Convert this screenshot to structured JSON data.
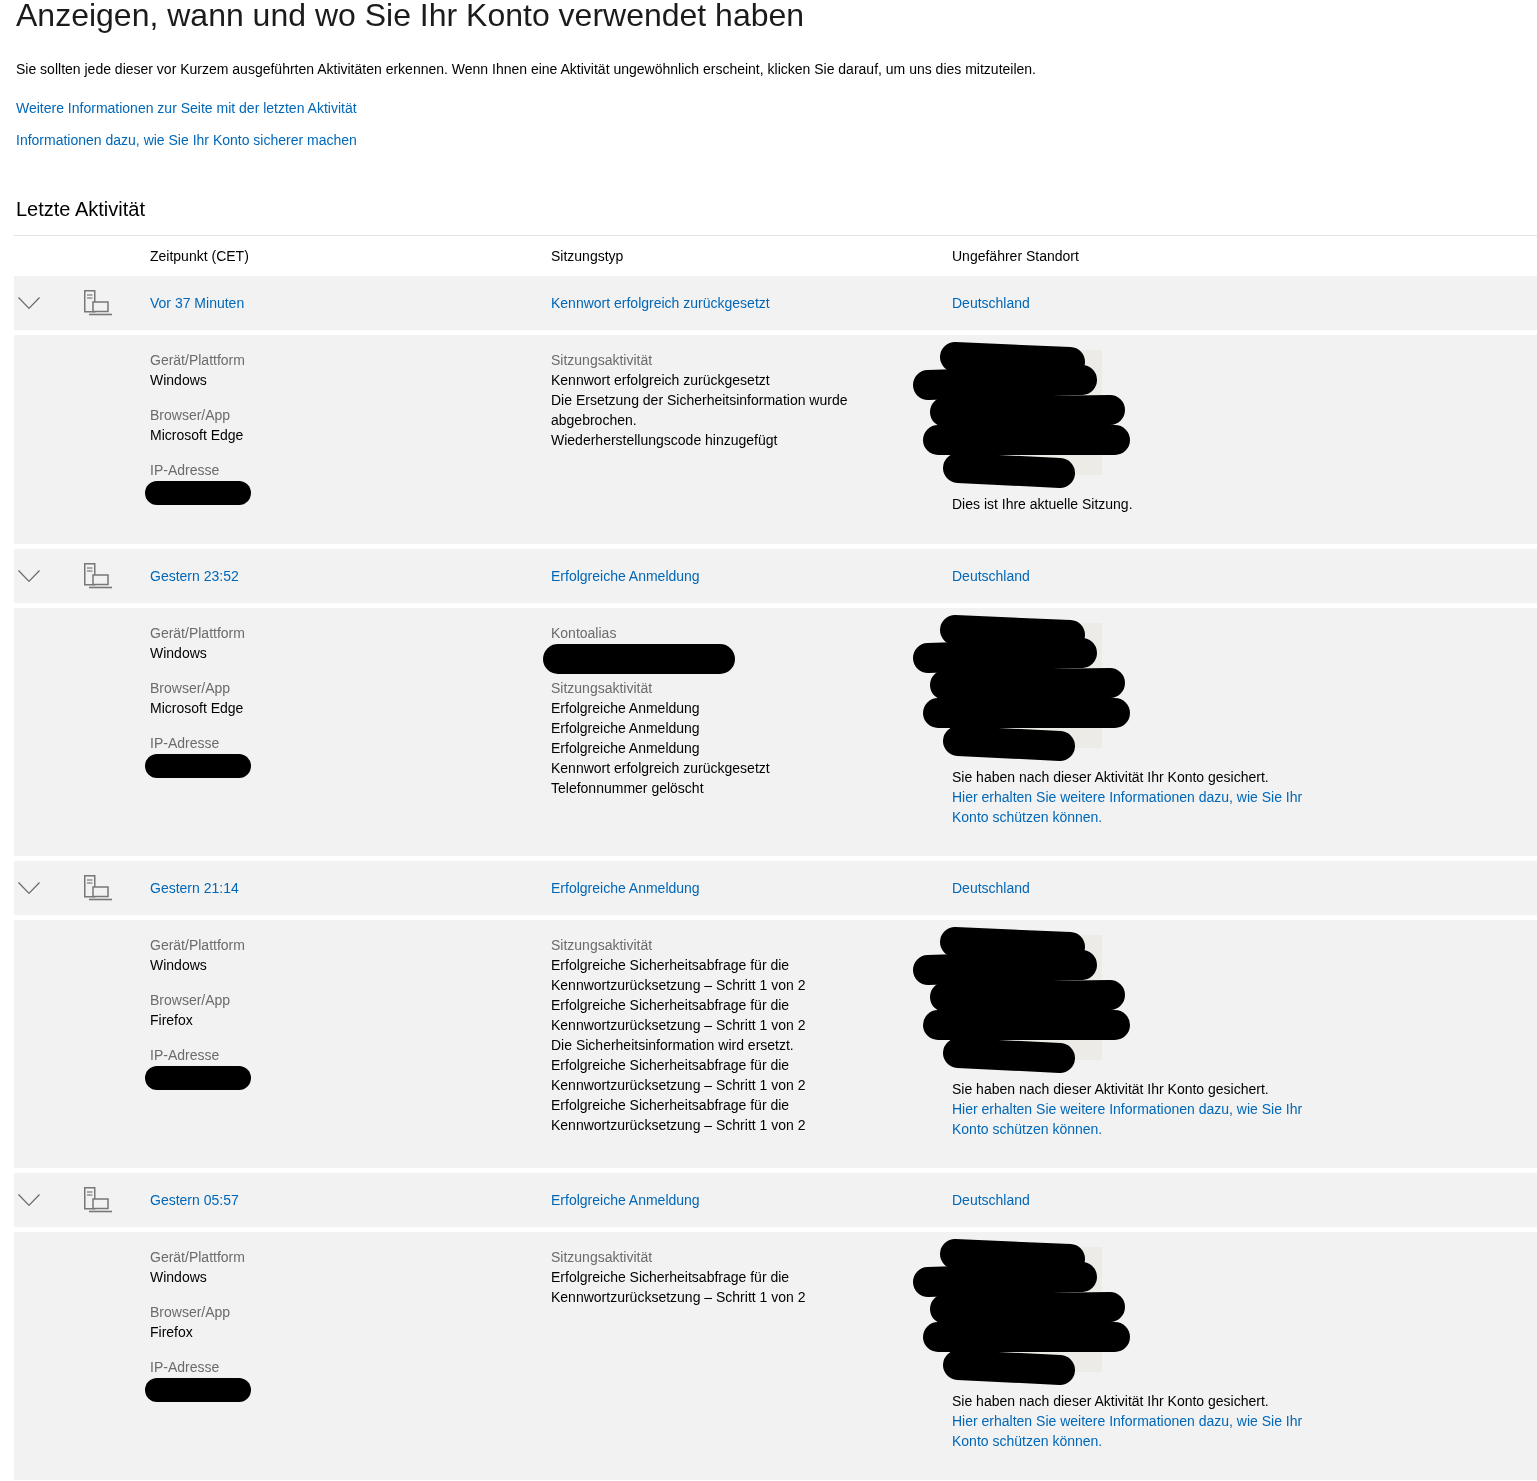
{
  "page_title": "Anzeigen, wann und wo Sie Ihr Konto verwendet haben",
  "intro": "Sie sollten jede dieser vor Kurzem ausgeführten Aktivitäten erkennen. Wenn Ihnen eine Aktivität ungewöhnlich erscheint, klicken Sie darauf, um uns dies mitzuteilen.",
  "links": [
    "Weitere Informationen zur Seite mit der letzten Aktivität",
    "Informationen dazu, wie Sie Ihr Konto sicherer machen"
  ],
  "section_title": "Letzte Aktivität",
  "table": {
    "columns": [
      "Zeitpunkt (CET)",
      "Sitzungstyp",
      "Ungefährer Standort"
    ],
    "rows": [
      {
        "expanded": true,
        "time": "Vor 37 Minuten",
        "session_type": "Kennwort erfolgreich zurückgesetzt",
        "location": "Deutschland",
        "details": {
          "fields": [
            {
              "label": "Gerät/Plattform",
              "value": "Windows"
            },
            {
              "label": "Browser/App",
              "value": "Microsoft Edge"
            },
            {
              "label": "IP-Adresse",
              "redacted": true
            }
          ],
          "activity_label": "Sitzungsaktivität",
          "activities": [
            "Kennwort erfolgreich zurückgesetzt",
            "Die Ersetzung der Sicherheitsinformation wurde abgebrochen.",
            "Wiederherstellungscode hinzugefügt"
          ],
          "map_redacted": true,
          "note": "Dies ist Ihre aktuelle Sitzung."
        }
      },
      {
        "expanded": true,
        "time": "Gestern 23:52",
        "session_type": "Erfolgreiche Anmeldung",
        "location": "Deutschland",
        "details": {
          "fields": [
            {
              "label": "Gerät/Plattform",
              "value": "Windows"
            },
            {
              "label": "Browser/App",
              "value": "Microsoft Edge"
            },
            {
              "label": "IP-Adresse",
              "redacted": true
            }
          ],
          "alias": {
            "label": "Kontoalias",
            "redacted": true
          },
          "activity_label": "Sitzungsaktivität",
          "activities": [
            "Erfolgreiche Anmeldung",
            "Erfolgreiche Anmeldung",
            "Erfolgreiche Anmeldung",
            "Kennwort erfolgreich zurückgesetzt",
            "Telefonnummer gelöscht"
          ],
          "map_redacted": true,
          "note": "Sie haben nach dieser Aktivität Ihr Konto gesichert.",
          "link": "Hier erhalten Sie weitere Informationen dazu, wie Sie Ihr Konto schützen können."
        }
      },
      {
        "expanded": true,
        "time": "Gestern 21:14",
        "session_type": "Erfolgreiche Anmeldung",
        "location": "Deutschland",
        "details": {
          "fields": [
            {
              "label": "Gerät/Plattform",
              "value": "Windows"
            },
            {
              "label": "Browser/App",
              "value": "Firefox"
            },
            {
              "label": "IP-Adresse",
              "redacted": true
            }
          ],
          "activity_label": "Sitzungsaktivität",
          "activities": [
            "Erfolgreiche Sicherheitsabfrage für die Kennwortzurücksetzung – Schritt 1 von 2",
            "Erfolgreiche Sicherheitsabfrage für die Kennwortzurücksetzung – Schritt 1 von 2",
            "Die Sicherheitsinformation wird ersetzt.",
            "Erfolgreiche Sicherheitsabfrage für die Kennwortzurücksetzung – Schritt 1 von 2",
            "Erfolgreiche Sicherheitsabfrage für die Kennwortzurücksetzung – Schritt 1 von 2"
          ],
          "map_redacted": true,
          "note": "Sie haben nach dieser Aktivität Ihr Konto gesichert.",
          "link": "Hier erhalten Sie weitere Informationen dazu, wie Sie Ihr Konto schützen können."
        }
      },
      {
        "expanded": true,
        "time": "Gestern 05:57",
        "session_type": "Erfolgreiche Anmeldung",
        "location": "Deutschland",
        "details": {
          "fields": [
            {
              "label": "Gerät/Plattform",
              "value": "Windows"
            },
            {
              "label": "Browser/App",
              "value": "Firefox"
            },
            {
              "label": "IP-Adresse",
              "redacted": true
            }
          ],
          "activity_label": "Sitzungsaktivität",
          "activities": [
            "Erfolgreiche Sicherheitsabfrage für die Kennwortzurücksetzung – Schritt 1 von 2"
          ],
          "map_redacted": true,
          "note": "Sie haben nach dieser Aktivität Ihr Konto gesichert.",
          "link": "Hier erhalten Sie weitere Informationen dazu, wie Sie Ihr Konto schützen können."
        }
      }
    ]
  }
}
